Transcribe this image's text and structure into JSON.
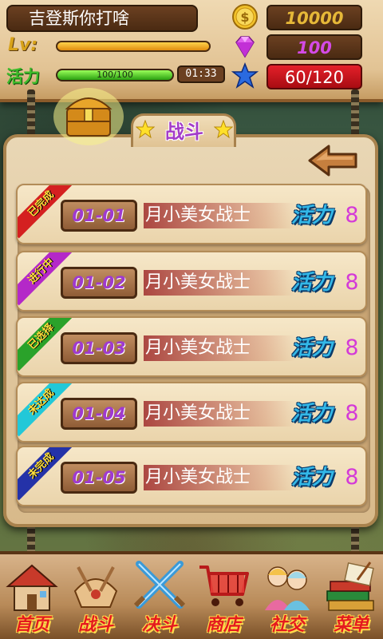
{
  "player": {
    "name": "吉登斯你打啥",
    "level_label": "Lv:",
    "level_progress": 1.0,
    "vitality_label": "活力",
    "vitality_text": "100/100",
    "vitality_progress": 1.0,
    "timer": "01:33"
  },
  "resources": {
    "gold": "10000",
    "gems": "100",
    "stars": "60/120"
  },
  "panel": {
    "title": "战斗"
  },
  "stages": [
    {
      "status": "已完成",
      "status_color": "#d42020",
      "code": "01-01",
      "name": "月小美女战士",
      "cost_label": "活力",
      "cost": "8"
    },
    {
      "status": "进行中",
      "status_color": "#b428c8",
      "code": "01-02",
      "name": "月小美女战士",
      "cost_label": "活力",
      "cost": "8"
    },
    {
      "status": "已选择",
      "status_color": "#2aa22a",
      "code": "01-03",
      "name": "月小美女战士",
      "cost_label": "活力",
      "cost": "8"
    },
    {
      "status": "未达成",
      "status_color": "#22c8d8",
      "code": "01-04",
      "name": "月小美女战士",
      "cost_label": "活力",
      "cost": "8"
    },
    {
      "status": "未完成",
      "status_color": "#2432a8",
      "code": "01-05",
      "name": "月小美女战士",
      "cost_label": "活力",
      "cost": "8"
    }
  ],
  "nav": [
    {
      "label": "首页",
      "icon": "house-icon"
    },
    {
      "label": "战斗",
      "icon": "battle-icon"
    },
    {
      "label": "决斗",
      "icon": "crossed-swords-icon"
    },
    {
      "label": "商店",
      "icon": "shopping-cart-icon"
    },
    {
      "label": "社交",
      "icon": "characters-icon"
    },
    {
      "label": "菜单",
      "icon": "books-icon"
    }
  ],
  "colors": {
    "gold_text": "#e6b838",
    "gem_text": "#d44ae6",
    "star_bg": "#e4202a",
    "nav_label": "#e4191f"
  }
}
